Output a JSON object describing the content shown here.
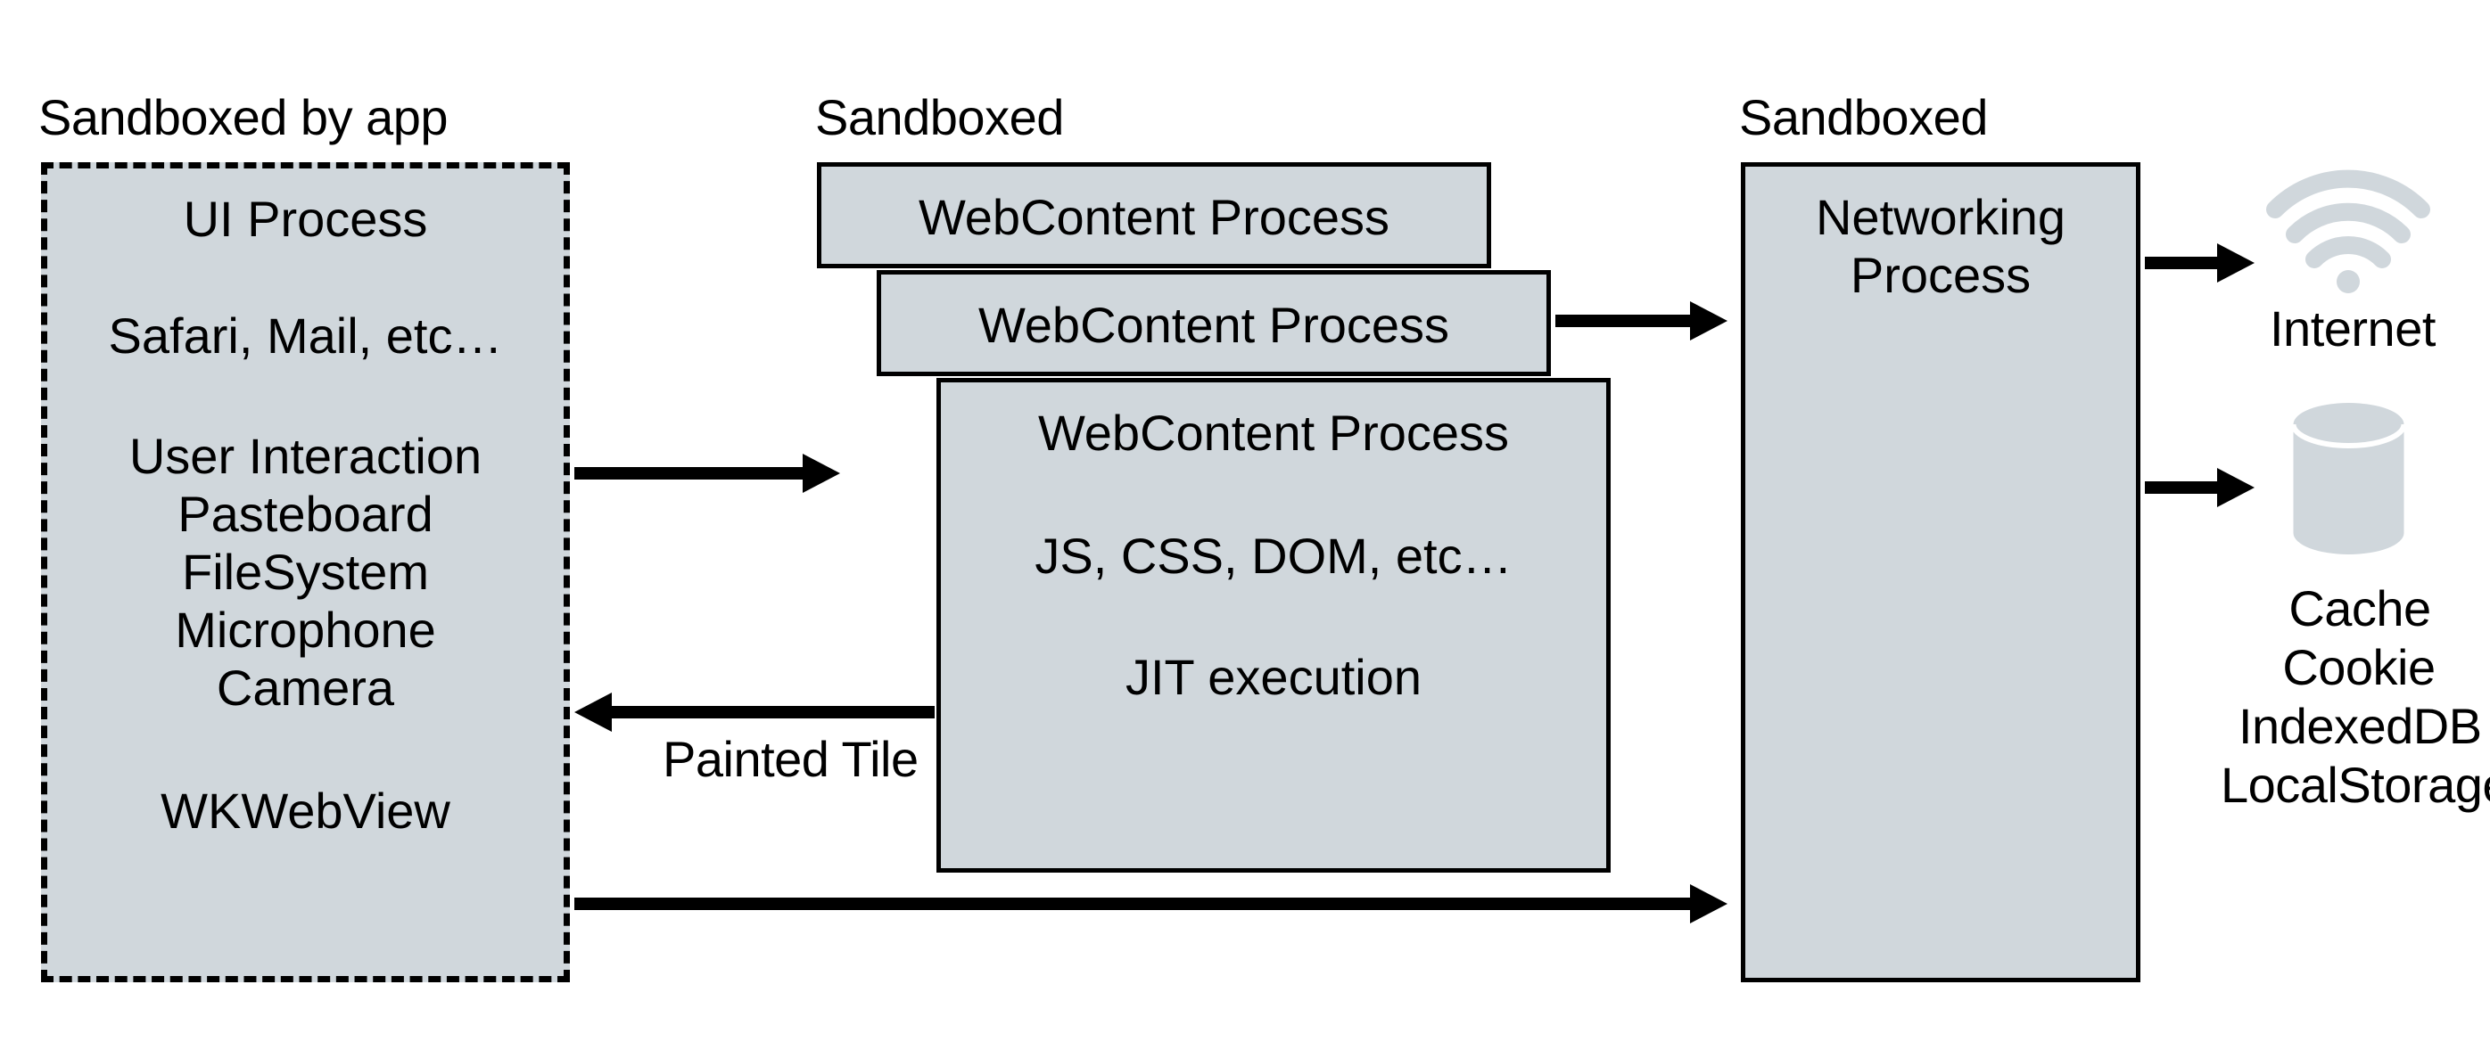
{
  "headers": {
    "ui": "Sandboxed by app",
    "web": "Sandboxed",
    "net": "Sandboxed"
  },
  "ui_process": {
    "title": "UI Process",
    "apps": "Safari, Mail, etc…",
    "cap1": "User Interaction",
    "cap2": "Pasteboard",
    "cap3": "FileSystem",
    "cap4": "Microphone",
    "cap5": "Camera",
    "view": "WKWebView"
  },
  "webcontent": {
    "title1": "WebContent Process",
    "title2": "WebContent Process",
    "title3": "WebContent Process",
    "body1": "JS, CSS, DOM, etc…",
    "body2": "JIT execution"
  },
  "networking": {
    "title": "Networking Process"
  },
  "arrows": {
    "painted_tile": "Painted Tile"
  },
  "internet": {
    "label": "Internet"
  },
  "storage": {
    "l1": "Cache",
    "l2": "Cookie",
    "l3": "IndexedDB",
    "l4": "LocalStorage"
  }
}
